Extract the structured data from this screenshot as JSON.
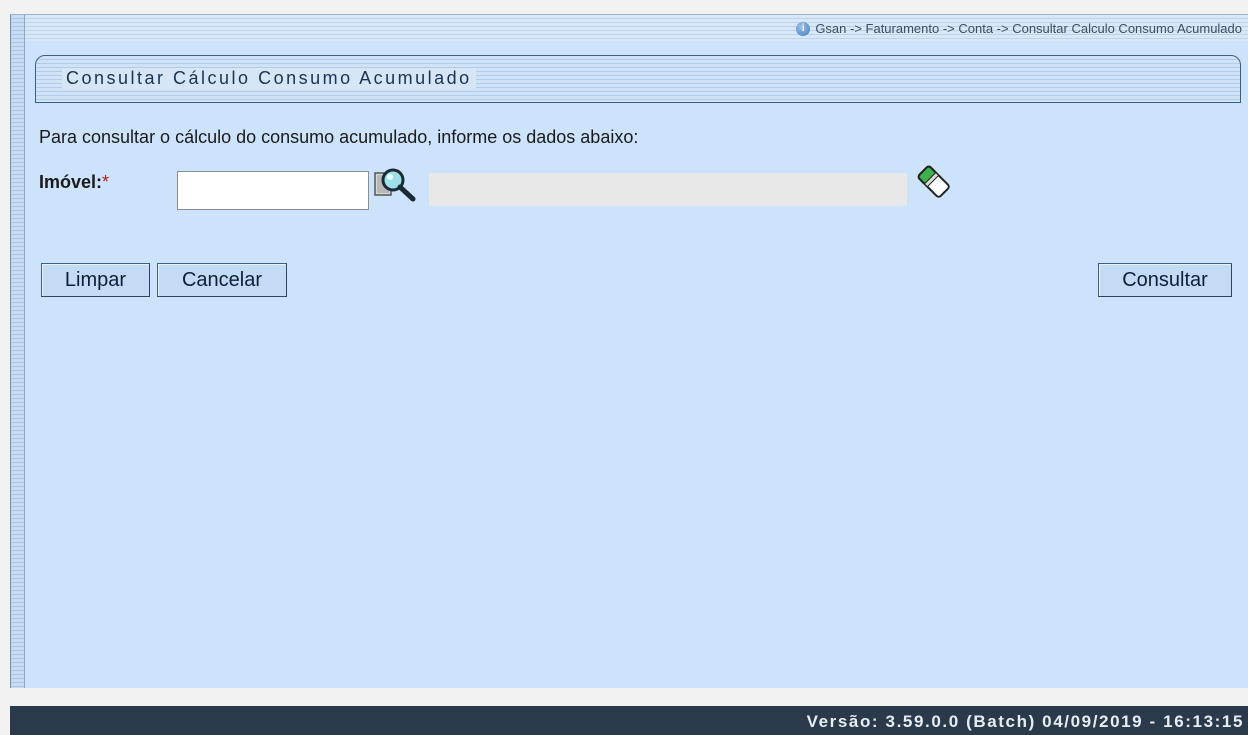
{
  "breadcrumb": "Gsan -> Faturamento -> Conta -> Consultar Calculo Consumo Acumulado",
  "page_title": "Consultar Cálculo Consumo Acumulado",
  "instructions": "Para consultar o cálculo do consumo acumulado, informe os dados abaixo:",
  "form": {
    "imovel_label": "Imóvel:",
    "required_mark": "*",
    "imovel_value": "",
    "descricao_value": ""
  },
  "buttons": {
    "limpar": "Limpar",
    "cancelar": "Cancelar",
    "consultar": "Consultar"
  },
  "footer": {
    "version": "Versão: 3.59.0.0 (Batch) 04/09/2019 - 16:13:15"
  },
  "colors": {
    "panel_bg": "#cce3fb",
    "footer_bg": "#2b3a4a",
    "required": "#c21a1a"
  },
  "icons": {
    "info": "info-icon",
    "search": "magnifier-search-icon",
    "erase": "eraser-icon"
  }
}
